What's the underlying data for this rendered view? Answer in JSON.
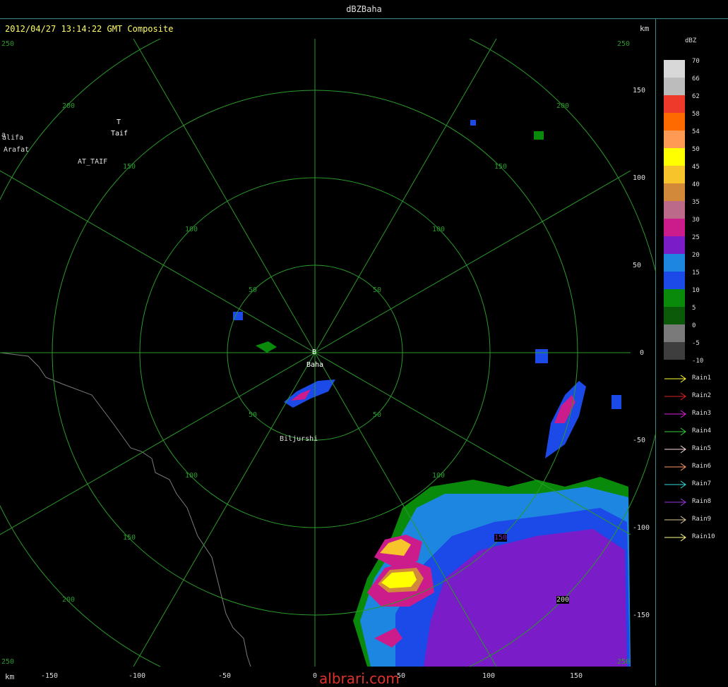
{
  "window": {
    "title": "dBZBaha"
  },
  "header": {
    "timestamp": "2012/04/27 13:14:22 GMT Composite",
    "km_top": "km",
    "km_bottom": "km"
  },
  "axes": {
    "right_ticks": [
      "150",
      "100",
      "50",
      "0",
      "-50",
      "-100",
      "-150"
    ],
    "bottom_ticks": [
      "-150",
      "-100",
      "-50",
      "0",
      "50",
      "100",
      "150"
    ]
  },
  "range_rings": {
    "labels_inner": [
      "50",
      "50",
      "50",
      "50"
    ],
    "labels_100": [
      "100",
      "100",
      "100",
      "100"
    ],
    "labels_150": [
      "150",
      "150",
      "150",
      "150"
    ],
    "labels_200": [
      "200",
      "200",
      "200",
      "200"
    ],
    "labels_250": [
      "250",
      "250",
      "250",
      "250"
    ]
  },
  "places": {
    "station_marker": "B",
    "station": "Baha",
    "taif_marker": "T",
    "taif": "Taif",
    "halifa": "alifa",
    "halifa_marker": "a",
    "arafat": "Arafat",
    "at_taif": "AT_TAIF",
    "biljurshi": "Biljurshi"
  },
  "overlay_labels": {
    "r150": "150",
    "r200": "200"
  },
  "legend": {
    "title": "dBZ",
    "scale": [
      {
        "label": "70",
        "color": "#d8d8d8"
      },
      {
        "label": "66",
        "color": "#bcbcbc"
      },
      {
        "label": "62",
        "color": "#ee3a2a"
      },
      {
        "label": "58",
        "color": "#ff6a00"
      },
      {
        "label": "54",
        "color": "#ff9a55"
      },
      {
        "label": "50",
        "color": "#ffff00"
      },
      {
        "label": "45",
        "color": "#f8c42c"
      },
      {
        "label": "40",
        "color": "#d28a3a"
      },
      {
        "label": "35",
        "color": "#bb6a8a"
      },
      {
        "label": "30",
        "color": "#cc1c8c"
      },
      {
        "label": "25",
        "color": "#7a1cc8"
      },
      {
        "label": "20",
        "color": "#1c86e0"
      },
      {
        "label": "15",
        "color": "#1c4ae8"
      },
      {
        "label": "10",
        "color": "#0a8a0a"
      },
      {
        "label": "5",
        "color": "#0a5a0a"
      },
      {
        "label": "0",
        "color": "#7a7a7a"
      },
      {
        "label": "-5",
        "color": "#3e3e3e"
      },
      {
        "label": "-10",
        "color": ""
      }
    ],
    "rain": [
      {
        "label": "Rain1",
        "color": "#ffff33"
      },
      {
        "label": "Rain2",
        "color": "#dd2222"
      },
      {
        "label": "Rain3",
        "color": "#dd22dd"
      },
      {
        "label": "Rain4",
        "color": "#33cc33"
      },
      {
        "label": "Rain5",
        "color": "#ffdddd"
      },
      {
        "label": "Rain6",
        "color": "#ff9966"
      },
      {
        "label": "Rain7",
        "color": "#33dddd"
      },
      {
        "label": "Rain8",
        "color": "#9933dd"
      },
      {
        "label": "Rain9",
        "color": "#ddcc99"
      },
      {
        "label": "Rain10",
        "color": "#ffff88"
      }
    ]
  },
  "watermark": "albrari.com"
}
